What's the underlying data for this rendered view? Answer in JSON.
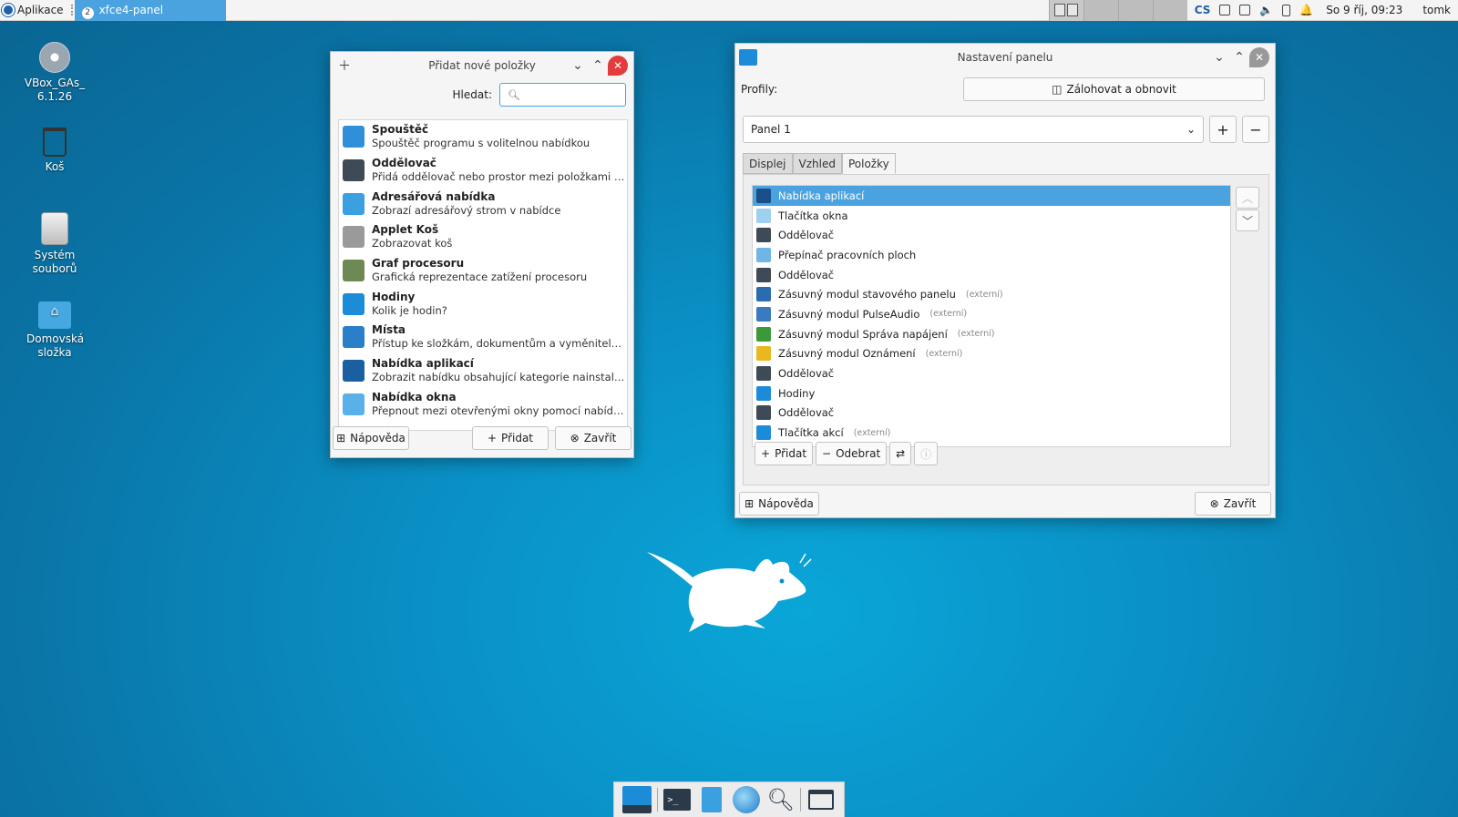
{
  "top_panel": {
    "apps_label": "Aplikace",
    "task_badge": "2",
    "task_label": "xfce4-panel",
    "keyboard_layout": "CS",
    "clock": "So 9 říj, 09:23",
    "user": "tomk"
  },
  "desktop": {
    "icons": [
      {
        "label": "VBox_GAs_6.1.26",
        "icon": "cd-icon"
      },
      {
        "label": "Koš",
        "icon": "trash-icon"
      },
      {
        "label": "Systém souborů",
        "icon": "drive-icon"
      },
      {
        "label": "Domovská složka",
        "icon": "home-folder-icon"
      }
    ]
  },
  "add_window": {
    "title": "Přidat nové položky",
    "search_label": "Hledat:",
    "search_placeholder": "",
    "items": [
      {
        "name": "Spouštěč",
        "desc": "Spouštěč programu s volitelnou nabídkou",
        "icon": "launcher-icon",
        "color": "#2f8fd8"
      },
      {
        "name": "Oddělovač",
        "desc": "Přidá oddělovač nebo prostor mezi položkami panelu",
        "icon": "separator-icon",
        "color": "#3e4a55"
      },
      {
        "name": "Adresářová nabídka",
        "desc": "Zobrazí adresářový strom v nabídce",
        "icon": "folder-icon",
        "color": "#3aa0e0"
      },
      {
        "name": "Applet Koš",
        "desc": "Zobrazovat koš",
        "icon": "trash-icon",
        "color": "#9a9a9a"
      },
      {
        "name": "Graf procesoru",
        "desc": "Grafická reprezentace zatížení procesoru",
        "icon": "cpu-graph-icon",
        "color": "#6d8a55"
      },
      {
        "name": "Hodiny",
        "desc": "Kolik je hodin?",
        "icon": "clock-icon",
        "color": "#1d8cd8"
      },
      {
        "name": "Místa",
        "desc": "Přístup ke složkám, dokumentům a vyměnitelným m...",
        "icon": "places-icon",
        "color": "#2a7fc8"
      },
      {
        "name": "Nabídka aplikací",
        "desc": "Zobrazit nabídku obsahující kategorie nainstalovanýc...",
        "icon": "xfce-mouse-icon",
        "color": "#1a5fa0"
      },
      {
        "name": "Nabídka okna",
        "desc": "Přepnout mezi otevřenými okny pomocí nabídky",
        "icon": "window-menu-icon",
        "color": "#5ab0e8"
      }
    ],
    "help_label": "Nápověda",
    "add_label": "Přidat",
    "close_label": "Zavřít"
  },
  "prefs_window": {
    "title": "Nastavení panelu",
    "profiles_label": "Profily:",
    "backup_label": "Zálohovat a obnovit",
    "panel_selected": "Panel 1",
    "tabs": [
      "Displej",
      "Vzhled",
      "Položky"
    ],
    "active_tab": "Položky",
    "items": [
      {
        "name": "Nabídka aplikací",
        "ext": "",
        "icon": "xfce-mouse-icon",
        "color": "#1a4f88",
        "selected": true
      },
      {
        "name": "Tlačítka okna",
        "ext": "",
        "icon": "window-buttons-icon",
        "color": "#9fd0f0"
      },
      {
        "name": "Oddělovač",
        "ext": "",
        "icon": "separator-icon",
        "color": "#3e4a55"
      },
      {
        "name": "Přepínač pracovních ploch",
        "ext": "",
        "icon": "workspace-switcher-icon",
        "color": "#6fb6e6"
      },
      {
        "name": "Oddělovač",
        "ext": "",
        "icon": "separator-icon",
        "color": "#3e4a55"
      },
      {
        "name": "Zásuvný modul stavového panelu",
        "ext": "(externí)",
        "icon": "megaphone-icon",
        "color": "#2a6cb0"
      },
      {
        "name": "Zásuvný modul PulseAudio",
        "ext": "(externí)",
        "icon": "audio-icon",
        "color": "#3a7ac0"
      },
      {
        "name": "Zásuvný modul Správa napájení",
        "ext": "(externí)",
        "icon": "battery-icon",
        "color": "#3a9a3a"
      },
      {
        "name": "Zásuvný modul Oznámení",
        "ext": "(externí)",
        "icon": "bell-icon",
        "color": "#e8b820"
      },
      {
        "name": "Oddělovač",
        "ext": "",
        "icon": "separator-icon",
        "color": "#3e4a55"
      },
      {
        "name": "Hodiny",
        "ext": "",
        "icon": "clock-icon",
        "color": "#1d8cd8"
      },
      {
        "name": "Oddělovač",
        "ext": "",
        "icon": "separator-icon",
        "color": "#3e4a55"
      },
      {
        "name": "Tlačítka akcí",
        "ext": "(externí)",
        "icon": "power-icon",
        "color": "#1d8cd8"
      }
    ],
    "add_label": "Přidat",
    "remove_label": "Odebrat",
    "help_label": "Nápověda",
    "close_label": "Zavřít"
  },
  "dock": {
    "items": [
      "show-desktop-icon",
      "terminal-icon",
      "file-manager-icon",
      "web-browser-icon",
      "app-finder-icon",
      "folder-icon"
    ]
  },
  "colors": {
    "accent": "#4aa3df",
    "desktop_bg": "#0a8fc4"
  }
}
